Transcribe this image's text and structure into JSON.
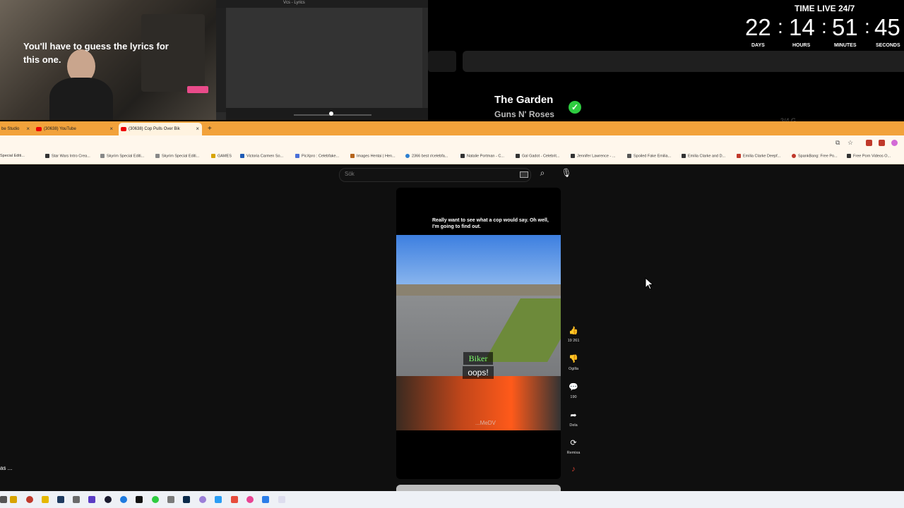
{
  "stream": {
    "lyrics_window_title": "Vcs - Lyrics",
    "lyrics_prompt": "You'll have to guess the lyrics for this one.",
    "song_title": "The Garden",
    "song_artist": "Guns N' Roses",
    "faded_text": "3/4 G...",
    "clock": {
      "label": "TIME LIVE 24/7",
      "days": "22",
      "hours": "14",
      "minutes": "51",
      "seconds": "45",
      "days_label": "DAYS",
      "hours_label": "HOURS",
      "minutes_label": "MINUTES",
      "seconds_label": "SECONDS"
    }
  },
  "browser": {
    "tabs": [
      {
        "label": "be Studio"
      },
      {
        "label": "(30638) YouTube"
      },
      {
        "label": "(30638) Cop Pulls Over Bik"
      }
    ],
    "new_tab": "+",
    "bookmarks": [
      "Special Editi...",
      "Star Wars Intro Crea...",
      "Skyrim Special Editi...",
      "Skyrim Special Editi...",
      "GAMES",
      "Victoria Carmen So...",
      "PicXpro : Celebfake...",
      "Images Hentai | Hen...",
      "2366 best r/celebfa...",
      "Natalie Portman - C...",
      "Gal Gadot - Celebrit...",
      "Jennifer Lawrence - ...",
      "Spoiled Fake Emilia...",
      "Emilia Clarke and D...",
      "Emilia Clarke Deepf...",
      "SpankBang: Free Po...",
      "Free Porn Videos O..."
    ]
  },
  "page": {
    "search_placeholder": "Sök",
    "caption_top": "Really want to see what a cop would say. Oh well, I'm going to find out.",
    "subtitle_1": "Biker",
    "subtitle_2": "oops!",
    "watermark": "...MeDV",
    "actions": {
      "like_count": "19 261",
      "dislike_label": "Ogilla",
      "comments_count": "190",
      "share_label": "Dela",
      "remix_label": "Remixa"
    },
    "side_text": "as ..."
  }
}
